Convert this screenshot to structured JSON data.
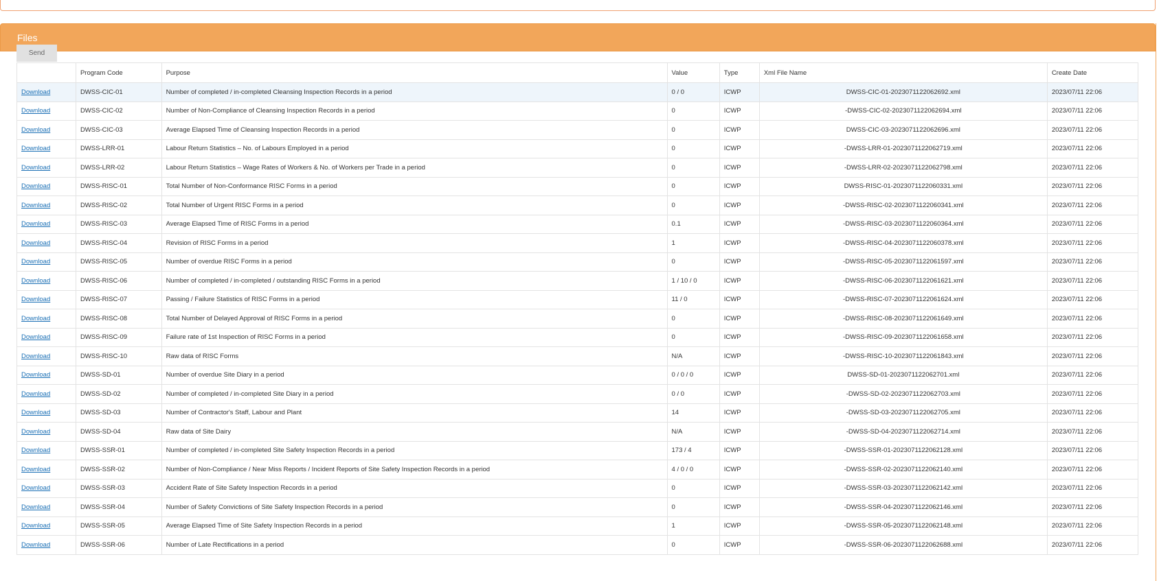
{
  "panel": {
    "title": "Files",
    "send_label": "Send"
  },
  "table": {
    "headers": [
      "",
      "Program Code",
      "Purpose",
      "Value",
      "Type",
      "Xml File Name",
      "Create Date"
    ],
    "rows": [
      {
        "link": "Download",
        "code": "DWSS-CIC-01",
        "purpose": "Number of completed / in-completed Cleansing Inspection Records in a period",
        "value": "0 / 0",
        "type": "ICWP",
        "xml": "DWSS-CIC-01-2023071122062692.xml",
        "date": "2023/07/11 22:06"
      },
      {
        "link": "Download",
        "code": "DWSS-CIC-02",
        "purpose": "Number of Non-Compliance of Cleansing Inspection Records in a period",
        "value": "0",
        "type": "ICWP",
        "xml": "-DWSS-CIC-02-2023071122062694.xml",
        "date": "2023/07/11 22:06"
      },
      {
        "link": "Download",
        "code": "DWSS-CIC-03",
        "purpose": "Average Elapsed Time of Cleansing Inspection Records in a period",
        "value": "0",
        "type": "ICWP",
        "xml": "DWSS-CIC-03-2023071122062696.xml",
        "date": "2023/07/11 22:06"
      },
      {
        "link": "Download",
        "code": "DWSS-LRR-01",
        "purpose": "Labour Return Statistics – No. of Labours Employed in a period",
        "value": "0",
        "type": "ICWP",
        "xml": "-DWSS-LRR-01-2023071122062719.xml",
        "date": "2023/07/11 22:06"
      },
      {
        "link": "Download",
        "code": "DWSS-LRR-02",
        "purpose": "Labour Return Statistics – Wage Rates of Workers & No. of Workers per Trade in a period",
        "value": "0",
        "type": "ICWP",
        "xml": "-DWSS-LRR-02-2023071122062798.xml",
        "date": "2023/07/11 22:06"
      },
      {
        "link": "Download",
        "code": "DWSS-RISC-01",
        "purpose": "Total Number of Non-Conformance RISC Forms in a period",
        "value": "0",
        "type": "ICWP",
        "xml": "DWSS-RISC-01-2023071122060331.xml",
        "date": "2023/07/11 22:06"
      },
      {
        "link": "Download",
        "code": "DWSS-RISC-02",
        "purpose": "Total Number of Urgent RISC Forms in a period",
        "value": "0",
        "type": "ICWP",
        "xml": "-DWSS-RISC-02-2023071122060341.xml",
        "date": "2023/07/11 22:06"
      },
      {
        "link": "Download",
        "code": "DWSS-RISC-03",
        "purpose": "Average Elapsed Time of RISC Forms in a period",
        "value": "0.1",
        "type": "ICWP",
        "xml": "-DWSS-RISC-03-2023071122060364.xml",
        "date": "2023/07/11 22:06"
      },
      {
        "link": "Download",
        "code": "DWSS-RISC-04",
        "purpose": "Revision of RISC Forms in a period",
        "value": "1",
        "type": "ICWP",
        "xml": "-DWSS-RISC-04-2023071122060378.xml",
        "date": "2023/07/11 22:06"
      },
      {
        "link": "Download",
        "code": "DWSS-RISC-05",
        "purpose": "Number of overdue RISC Forms in a period",
        "value": "0",
        "type": "ICWP",
        "xml": "-DWSS-RISC-05-2023071122061597.xml",
        "date": "2023/07/11 22:06"
      },
      {
        "link": "Download",
        "code": "DWSS-RISC-06",
        "purpose": "Number of completed / in-completed / outstanding RISC Forms in a period",
        "value": "1 / 10 / 0",
        "type": "ICWP",
        "xml": "-DWSS-RISC-06-2023071122061621.xml",
        "date": "2023/07/11 22:06"
      },
      {
        "link": "Download",
        "code": "DWSS-RISC-07",
        "purpose": "Passing / Failure Statistics of RISC Forms in a period",
        "value": "11 / 0",
        "type": "ICWP",
        "xml": "-DWSS-RISC-07-2023071122061624.xml",
        "date": "2023/07/11 22:06"
      },
      {
        "link": "Download",
        "code": "DWSS-RISC-08",
        "purpose": "Total Number of Delayed Approval of RISC Forms in a period",
        "value": "0",
        "type": "ICWP",
        "xml": "-DWSS-RISC-08-2023071122061649.xml",
        "date": "2023/07/11 22:06"
      },
      {
        "link": "Download",
        "code": "DWSS-RISC-09",
        "purpose": "Failure rate of 1st Inspection of RISC Forms in a period",
        "value": "0",
        "type": "ICWP",
        "xml": "-DWSS-RISC-09-2023071122061658.xml",
        "date": "2023/07/11 22:06"
      },
      {
        "link": "Download",
        "code": "DWSS-RISC-10",
        "purpose": "Raw data of RISC Forms",
        "value": "N/A",
        "type": "ICWP",
        "xml": "-DWSS-RISC-10-2023071122061843.xml",
        "date": "2023/07/11 22:06"
      },
      {
        "link": "Download",
        "code": "DWSS-SD-01",
        "purpose": "Number of overdue Site Diary in a period",
        "value": "0 / 0 / 0",
        "type": "ICWP",
        "xml": "DWSS-SD-01-2023071122062701.xml",
        "date": "2023/07/11 22:06"
      },
      {
        "link": "Download",
        "code": "DWSS-SD-02",
        "purpose": "Number of completed / in-completed Site Diary in a period",
        "value": "0 / 0",
        "type": "ICWP",
        "xml": "-DWSS-SD-02-2023071122062703.xml",
        "date": "2023/07/11 22:06"
      },
      {
        "link": "Download",
        "code": "DWSS-SD-03",
        "purpose": "Number of Contractor's Staff, Labour and Plant",
        "value": "14",
        "type": "ICWP",
        "xml": "-DWSS-SD-03-2023071122062705.xml",
        "date": "2023/07/11 22:06"
      },
      {
        "link": "Download",
        "code": "DWSS-SD-04",
        "purpose": "Raw data of Site Dairy",
        "value": "N/A",
        "type": "ICWP",
        "xml": "-DWSS-SD-04-2023071122062714.xml",
        "date": "2023/07/11 22:06"
      },
      {
        "link": "Download",
        "code": "DWSS-SSR-01",
        "purpose": "Number of completed / in-completed Site Safety Inspection Records in a period",
        "value": "173 / 4",
        "type": "ICWP",
        "xml": "-DWSS-SSR-01-2023071122062128.xml",
        "date": "2023/07/11 22:06"
      },
      {
        "link": "Download",
        "code": "DWSS-SSR-02",
        "purpose": "Number of Non-Compliance / Near Miss Reports / Incident Reports of Site Safety Inspection Records in a period",
        "value": "4 / 0 / 0",
        "type": "ICWP",
        "xml": "-DWSS-SSR-02-2023071122062140.xml",
        "date": "2023/07/11 22:06"
      },
      {
        "link": "Download",
        "code": "DWSS-SSR-03",
        "purpose": "Accident Rate of Site Safety Inspection Records in a period",
        "value": "0",
        "type": "ICWP",
        "xml": "-DWSS-SSR-03-2023071122062142.xml",
        "date": "2023/07/11 22:06"
      },
      {
        "link": "Download",
        "code": "DWSS-SSR-04",
        "purpose": "Number of Safety Convictions of Site Safety Inspection Records in a period",
        "value": "0",
        "type": "ICWP",
        "xml": "-DWSS-SSR-04-2023071122062146.xml",
        "date": "2023/07/11 22:06"
      },
      {
        "link": "Download",
        "code": "DWSS-SSR-05",
        "purpose": "Average Elapsed Time of Site Safety Inspection Records in a period",
        "value": "1",
        "type": "ICWP",
        "xml": "-DWSS-SSR-05-2023071122062148.xml",
        "date": "2023/07/11 22:06"
      },
      {
        "link": "Download",
        "code": "DWSS-SSR-06",
        "purpose": "Number of Late Rectifications in a period",
        "value": "0",
        "type": "ICWP",
        "xml": "-DWSS-SSR-06-2023071122062688.xml",
        "date": "2023/07/11 22:06"
      }
    ]
  },
  "colors": {
    "header_bg": "#f2a65a",
    "link": "#1a6fb5",
    "highlight_row": "#eef5fb"
  }
}
